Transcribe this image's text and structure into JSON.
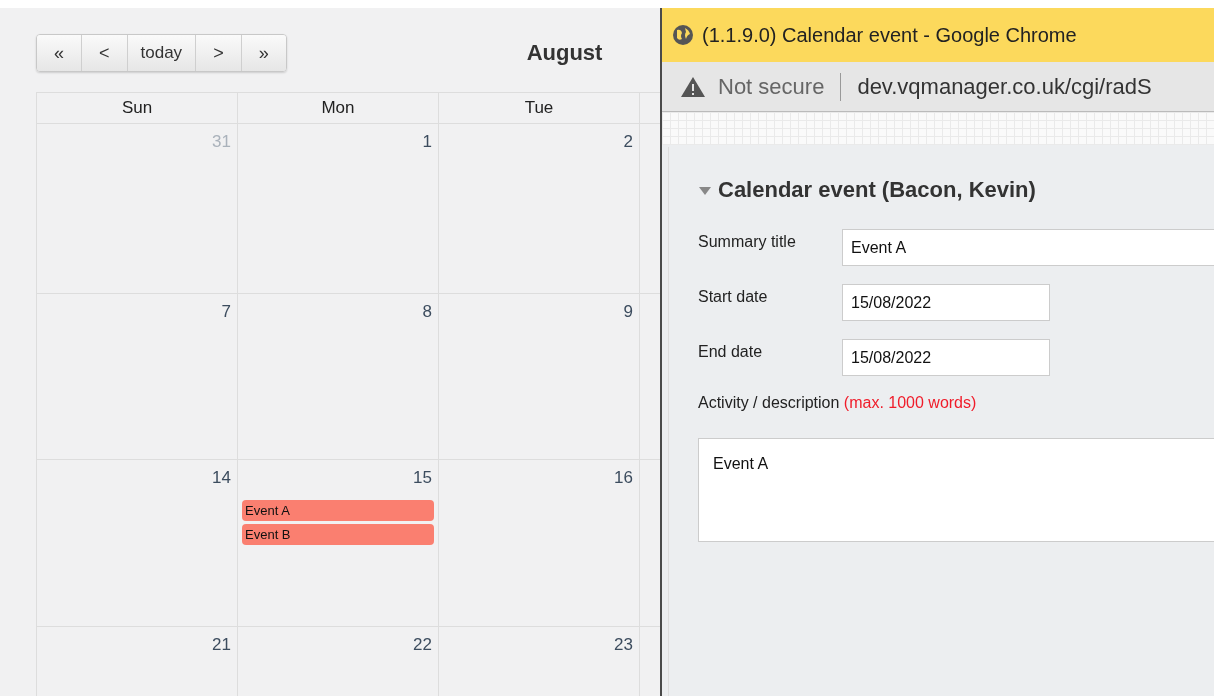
{
  "calendar": {
    "nav_buttons": [
      {
        "kind": "first",
        "label": "«"
      },
      {
        "kind": "prev",
        "label": "<"
      },
      {
        "kind": "today",
        "label": "today"
      },
      {
        "kind": "next",
        "label": ">"
      },
      {
        "kind": "last",
        "label": "»"
      }
    ],
    "title": "August",
    "weekdays": [
      "Sun",
      "Mon",
      "Tue"
    ],
    "weeks": [
      {
        "days": [
          {
            "label": "31",
            "other_month": true
          },
          {
            "label": "1",
            "other_month": false
          },
          {
            "label": "2",
            "other_month": false
          }
        ]
      },
      {
        "days": [
          {
            "label": "7",
            "other_month": false
          },
          {
            "label": "8",
            "other_month": false
          },
          {
            "label": "9",
            "other_month": false
          }
        ]
      },
      {
        "days": [
          {
            "label": "14",
            "other_month": false
          },
          {
            "label": "15",
            "other_month": false,
            "events": [
              "Event A",
              "Event B"
            ]
          },
          {
            "label": "16",
            "other_month": false
          }
        ]
      },
      {
        "days": [
          {
            "label": "21",
            "other_month": false
          },
          {
            "label": "22",
            "other_month": false
          },
          {
            "label": "23",
            "other_month": false
          }
        ]
      }
    ]
  },
  "popup": {
    "window_title": "(1.1.9.0) Calendar event - Google Chrome",
    "security": "Not secure",
    "url": "dev.vqmanager.co.uk/cgi/radS",
    "form": {
      "heading": "Calendar event (Bacon, Kevin)",
      "expanded": true,
      "fields": [
        {
          "kind": "wide",
          "label": "Summary title",
          "value": "Event A"
        },
        {
          "kind": "date",
          "label": "Start date",
          "value": "15/08/2022"
        },
        {
          "kind": "date",
          "label": "End date",
          "value": "15/08/2022"
        }
      ],
      "description": {
        "label": "Activity / description",
        "note": "(max. 1000 words)",
        "value": "Event A"
      }
    }
  }
}
